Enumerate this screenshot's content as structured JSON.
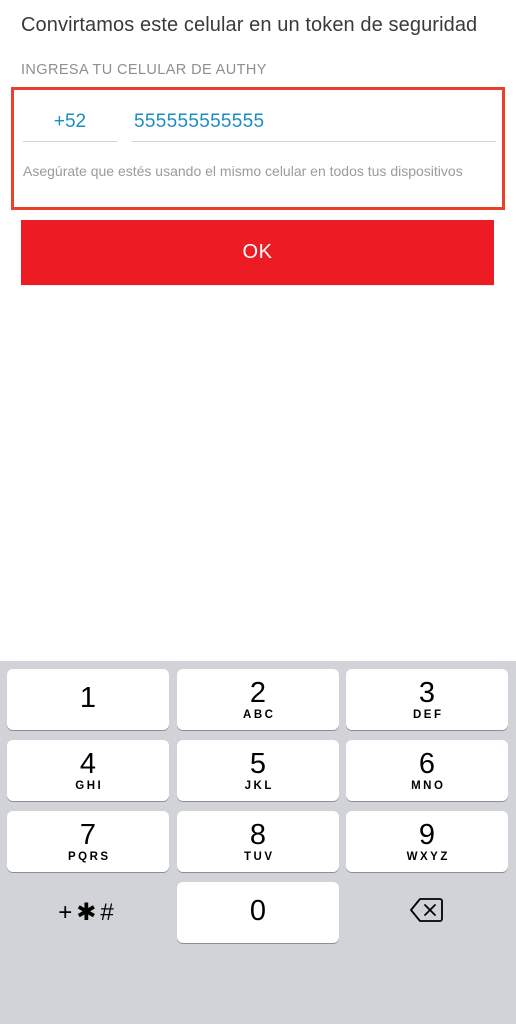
{
  "screen": {
    "heading": "Convirtamos este celular en un token de seguridad",
    "section_label": "INGRESA TU CELULAR DE AUTHY"
  },
  "form": {
    "country_code": "+52",
    "phone_value": "555555555555",
    "hint": "Asegúrate que estés usando el mismo celular en todos tus dispositivos",
    "ok_label": "OK"
  },
  "colors": {
    "highlight_border": "#e8412c",
    "button_red": "#ed1c24",
    "input_text_blue": "#1b8ec2"
  },
  "keyboard": {
    "keys": [
      {
        "digit": "1",
        "letters": ""
      },
      {
        "digit": "2",
        "letters": "ABC"
      },
      {
        "digit": "3",
        "letters": "DEF"
      },
      {
        "digit": "4",
        "letters": "GHI"
      },
      {
        "digit": "5",
        "letters": "JKL"
      },
      {
        "digit": "6",
        "letters": "MNO"
      },
      {
        "digit": "7",
        "letters": "PQRS"
      },
      {
        "digit": "8",
        "letters": "TUV"
      },
      {
        "digit": "9",
        "letters": "WXYZ"
      }
    ],
    "symbols_label": "+✱#",
    "zero": "0",
    "delete_icon": "backspace-icon"
  }
}
